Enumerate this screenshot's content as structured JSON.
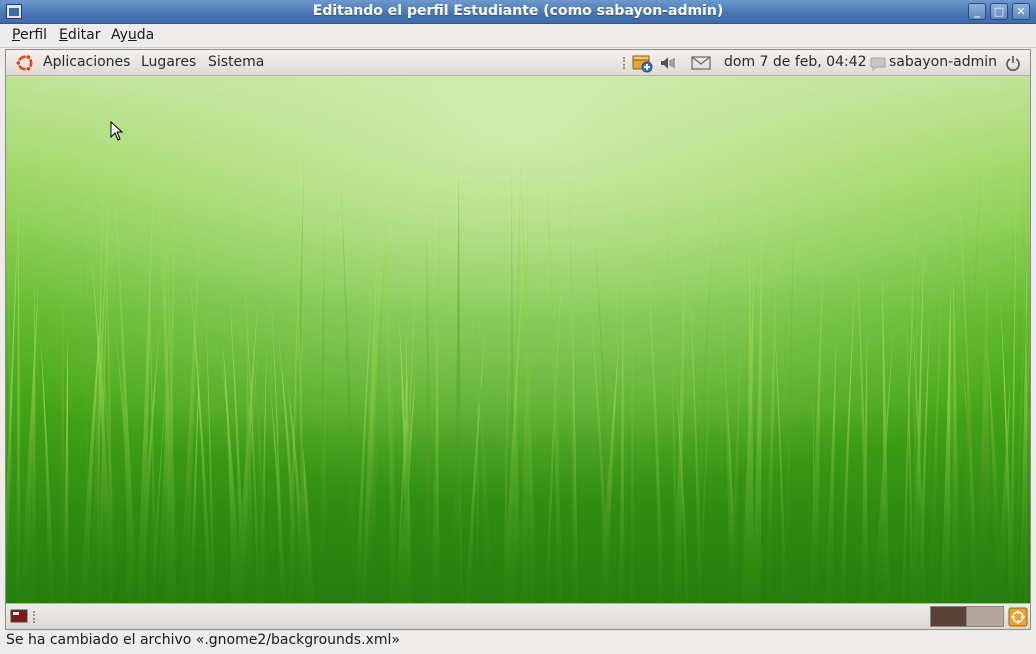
{
  "window": {
    "title": "Editando el perfil Estudiante (como sabayon-admin)",
    "buttons": {
      "minimize": "_",
      "maximize": "□",
      "close": "✕"
    }
  },
  "menubar": {
    "items": [
      {
        "mnemonic": "P",
        "rest": "erfil"
      },
      {
        "mnemonic": "E",
        "rest": "ditar"
      },
      {
        "prefix": "Ay",
        "mnemonic": "u",
        "rest": "da"
      }
    ]
  },
  "top_panel": {
    "menus": [
      "Aplicaciones",
      "Lugares",
      "Sistema"
    ],
    "clock": "dom  7 de feb, 04:42",
    "user": "sabayon-admin",
    "icons": [
      "ubuntu-logo-icon",
      "update-notifier-icon",
      "volume-icon",
      "mail-icon",
      "chat-status-icon",
      "power-icon"
    ]
  },
  "bottom_panel": {
    "icons": [
      "show-desktop-icon",
      "workspace-switcher",
      "trash-icon"
    ],
    "workspace_colors": [
      "#5a4238",
      "#b4a69b"
    ]
  },
  "statusbar": {
    "message": "Se ha cambiado el archivo «.gnome2/backgrounds.xml»"
  },
  "colors": {
    "titlebar": "#4a78b5",
    "wallpaper_green": "#4fae1b"
  }
}
